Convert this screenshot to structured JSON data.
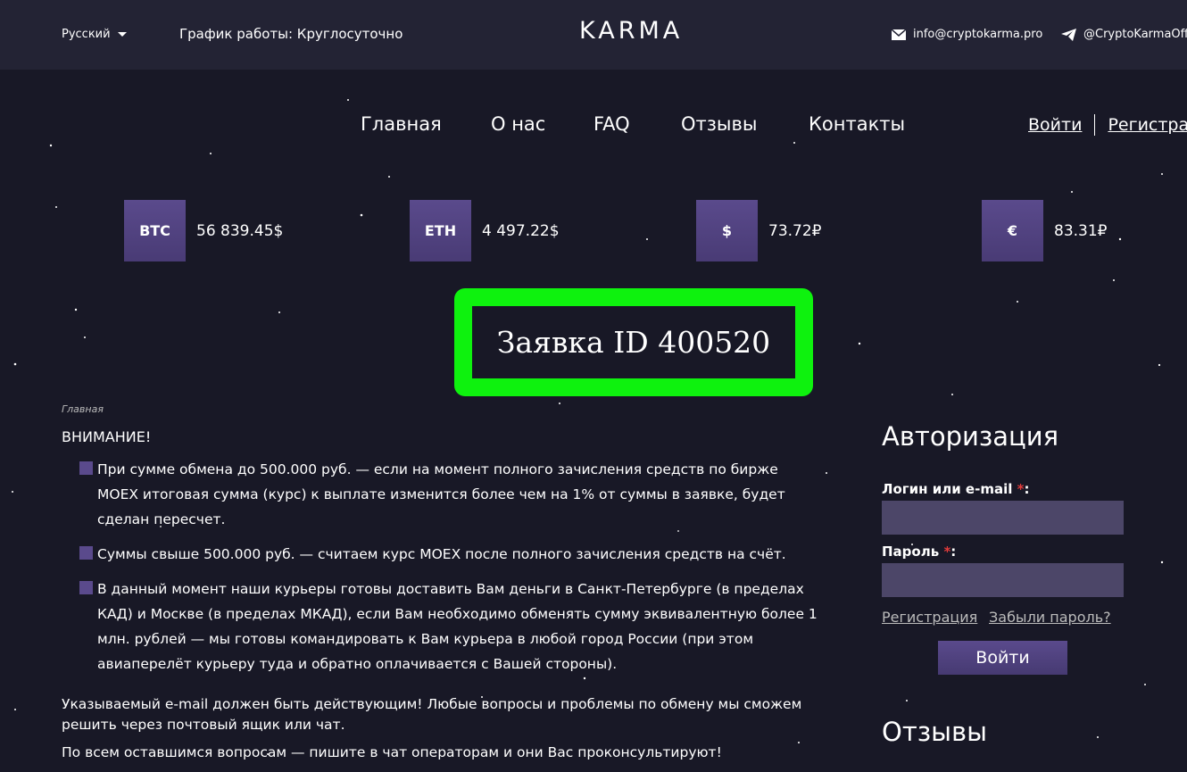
{
  "header": {
    "language": "Русский",
    "hours": "График работы: Круглосуточно",
    "logo": "KARMA",
    "email": "info@cryptokarma.pro",
    "telegram": "@CryptoKarmaOffic"
  },
  "nav": {
    "items": [
      "Главная",
      "О нас",
      "FAQ",
      "Отзывы",
      "Контакты"
    ],
    "login": "Войти",
    "register": "Регистрация"
  },
  "rates": [
    {
      "symbol": "BTC",
      "value": "56 839.45$"
    },
    {
      "symbol": "ETH",
      "value": "4 497.22$"
    },
    {
      "symbol": "$",
      "value": "73.72₽"
    },
    {
      "symbol": "€",
      "value": "83.31₽"
    }
  ],
  "page": {
    "title": "Заявка ID 400520",
    "breadcrumb": "Главная",
    "warning": "ВНИМАНИЕ!",
    "bullets": [
      "При сумме обмена до 500.000 руб. — если на момент полного зачисления средств по бирже МОЕХ итоговая сумма (курс) к выплате изменится более чем на 1% от суммы в заявке, будет сделан пересчет.",
      "Суммы свыше 500.000 руб. — считаем курс МОЕХ после полного зачисления средств на счёт.",
      "В данный момент наши курьеры готовы доставить Вам деньги в Санкт-Петербурге (в пределах КАД) и Москве (в пределах МКАД), если Вам необходимо обменять сумму эквивалентную более 1 млн. рублей — мы готовы командировать к Вам курьера в любой город России (при этом авиаперелёт курьеру туда и обратно оплачивается с Вашей стороны)."
    ],
    "note_email": "Указываемый e-mail должен быть действующим! Любые вопросы и проблемы по обмену мы сможем решить через почтовый ящик или чат.",
    "note_chat": "По всем оставшимся вопросам — пишите в чат операторам и они Вас проконсультируют!"
  },
  "auth": {
    "title": "Авторизация",
    "login_label": "Логин или e-mail",
    "password_label": "Пароль",
    "required_mark": "*",
    "colon": ":",
    "login_value": "",
    "password_value": "",
    "register_link": "Регистрация",
    "forgot_link": "Забыли пароль?",
    "submit": "Войти"
  },
  "reviews": {
    "title": "Отзывы"
  },
  "colors": {
    "background": "#181826",
    "topbar": "#232334",
    "accent": "#5a4a8c",
    "highlight": "#0ef20e",
    "required": "#e23b3b"
  }
}
